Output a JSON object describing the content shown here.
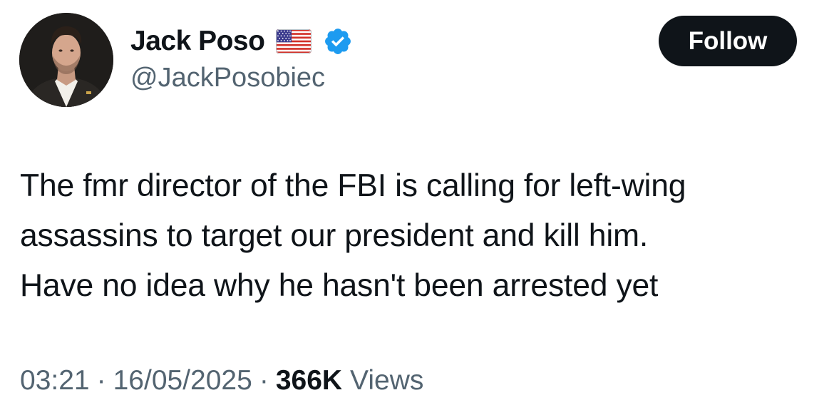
{
  "author": {
    "display_name": "Jack Poso",
    "handle": "@JackPosobiec",
    "flag_icon": "us-flag-icon",
    "verified_icon": "verified-badge-icon",
    "verified_color": "#1d9bf0"
  },
  "actions": {
    "follow_label": "Follow"
  },
  "tweet": {
    "lines": [
      "The fmr director of the FBI is calling for left-wing",
      "assassins to target our president and kill him.",
      "Have no idea why he hasn't been arrested yet"
    ]
  },
  "meta": {
    "time": "03:21",
    "separator": "·",
    "date": "16/05/2025",
    "views_count": "366K",
    "views_label": "Views"
  },
  "colors": {
    "text_primary": "#0f1419",
    "text_secondary": "#536471",
    "button_bg": "#0f1419",
    "button_text": "#ffffff"
  }
}
